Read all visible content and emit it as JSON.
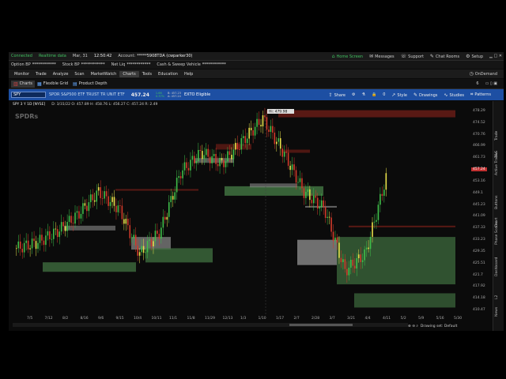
{
  "topbar": {
    "connected": "Connected",
    "realtime": "Realtime data",
    "date": "Mar, 31",
    "time": "12:50:42",
    "account_label": "Account:",
    "account_value": "*****5908TDA (cwparker30)",
    "home_screen": "Home Screen",
    "messages": "Messages",
    "support": "Support",
    "chat_rooms": "Chat Rooms",
    "setup": "Setup"
  },
  "balances": {
    "option_bp_label": "Option BP",
    "option_bp_value": "************",
    "stock_bp_label": "Stock BP",
    "stock_bp_value": "************",
    "net_liq_label": "Net Liq",
    "net_liq_value": "************",
    "cash_label": "Cash & Sweep Vehicle",
    "cash_value": "************"
  },
  "nav": {
    "items": [
      "Monitor",
      "Trade",
      "Analyze",
      "Scan",
      "MarketWatch",
      "Charts",
      "Tools",
      "Education",
      "Help"
    ],
    "active": "Charts",
    "on_demand": "OnDemand"
  },
  "subnav": {
    "charts": "Charts",
    "flexible_grid": "Flexible Grid",
    "product_depth": "Product Depth",
    "page_num": "6"
  },
  "symbolbar": {
    "symbol": "SPY",
    "description": "SPDR S&P500 ETF TRUST TR UNIT ETF",
    "price": "457.24",
    "change": "1.66",
    "change_pct": "0.37%",
    "bid": "B: 457.23",
    "ask": "A: 457.24",
    "ext": "EXTO Eligible",
    "share": "Share",
    "style": "Style",
    "drawings": "Drawings",
    "studies": "Studies",
    "patterns": "Patterns",
    "count": "0"
  },
  "chart_header": {
    "title": "SPY 3 Y 1D [NYSE]",
    "ohlc": "D: 3/31/22  O: 457.89  H: 458.76  L: 456.27  C: 457.24  R: 2.49",
    "hi_label": "Hi: 479.98",
    "watermark": "SPDRs"
  },
  "yaxis": {
    "labels": [
      "478.29",
      "474.52",
      "470.76",
      "466.99",
      "461.73",
      "457.24",
      "453.16",
      "449.1",
      "445.23",
      "441.09",
      "437.33",
      "433.23",
      "429.35",
      "425.51",
      "421.7",
      "417.92",
      "414.18",
      "410.47"
    ],
    "current": "457.24"
  },
  "xaxis": {
    "labels": [
      "7/5",
      "7/12",
      "8/2",
      "8/16",
      "9/6",
      "9/15",
      "10/4",
      "10/11",
      "11/1",
      "11/8",
      "11/29",
      "12/13",
      "1/3",
      "1/10",
      "1/17",
      "2/7",
      "2/28",
      "3/7",
      "3/21",
      "4/4",
      "4/11",
      "5/2",
      "5/9",
      "5/16",
      "5/30"
    ]
  },
  "sidetabs": [
    "Trade",
    "T&S",
    "Active Trader",
    "Buttons",
    "Chart",
    "Phase Scores",
    "Dashboard",
    "L2",
    "News"
  ],
  "footer": {
    "drawing_set": "Drawing set: Default"
  },
  "colors": {
    "accent_blue": "#1d4fa3",
    "green": "#40c060",
    "red": "#c03030",
    "zone_green": "#3d6b3d",
    "zone_red": "#6b1d16",
    "zone_gray": "#8a8a8a"
  },
  "chart_data": {
    "type": "candlestick",
    "symbol": "SPY",
    "ylim": [
      408,
      482
    ],
    "x": [
      "7/5",
      "7/12",
      "8/2",
      "8/16",
      "9/6",
      "9/15",
      "10/4",
      "10/11",
      "11/1",
      "11/8",
      "11/29",
      "12/13",
      "1/3",
      "1/10",
      "1/17",
      "2/7",
      "2/28",
      "3/7",
      "3/21"
    ],
    "close": [
      432,
      434,
      438,
      444,
      452,
      446,
      430,
      438,
      459,
      466,
      462,
      470,
      478,
      466,
      452,
      446,
      424,
      430,
      457
    ]
  }
}
